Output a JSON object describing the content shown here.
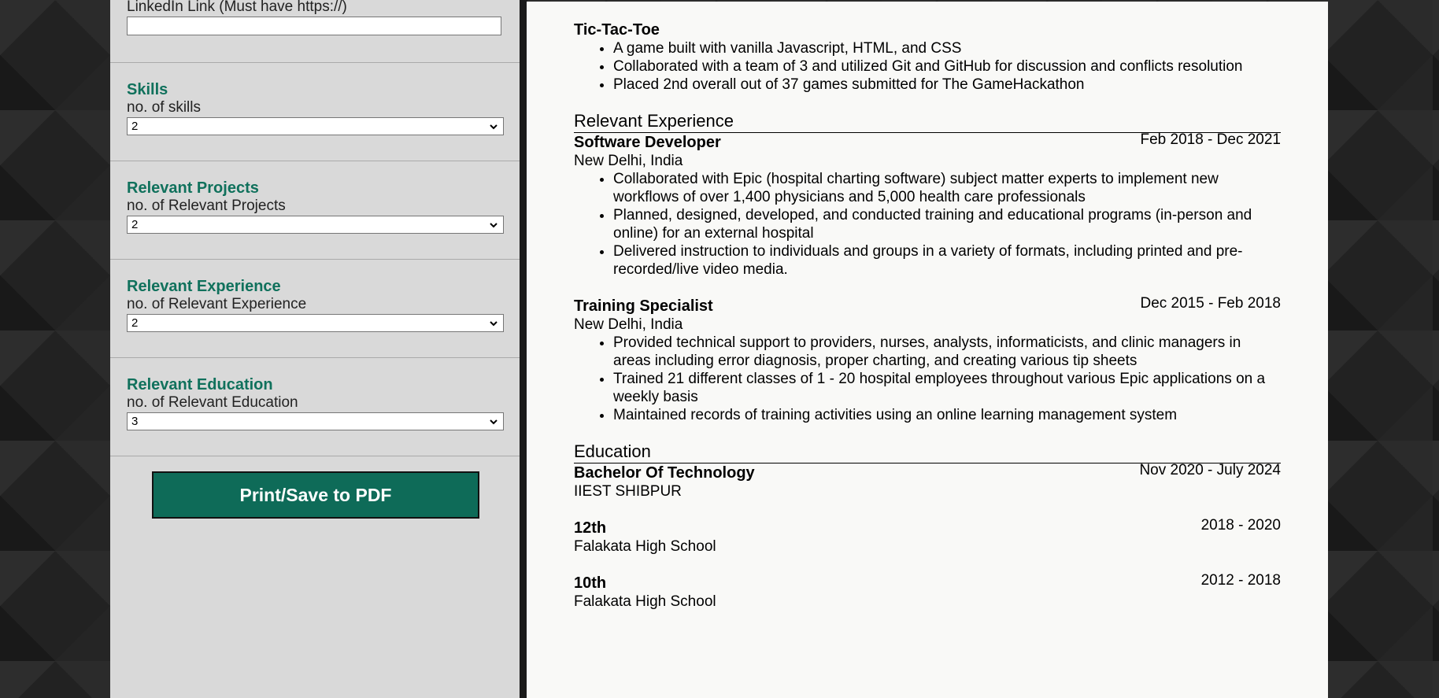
{
  "form": {
    "linkedin_label": "LinkedIn Link (Must have https://)",
    "linkedin_value": "",
    "sections": [
      {
        "title": "Skills",
        "sub": "no. of skills",
        "value": "2"
      },
      {
        "title": "Relevant Projects",
        "sub": "no. of Relevant Projects",
        "value": "2"
      },
      {
        "title": "Relevant Experience",
        "sub": "no. of Relevant Experience",
        "value": "2"
      },
      {
        "title": "Relevant Education",
        "sub": "no. of Relevant Education",
        "value": "3"
      }
    ],
    "print_label": "Print/Save to PDF"
  },
  "resume": {
    "project": {
      "title": "Tic-Tac-Toe",
      "bullets": [
        "A game built with vanilla Javascript, HTML, and CSS",
        "Collaborated with a team of 3 and utilized Git and GitHub for discussion and conflicts resolution",
        "Placed 2nd overall out of 37 games submitted for The GameHackathon"
      ]
    },
    "experience_heading": "Relevant Experience",
    "experience": [
      {
        "title": "Software Developer",
        "date": "Feb 2018 - Dec 2021",
        "location": "New Delhi, India",
        "bullets": [
          "Collaborated with Epic (hospital charting software) subject matter experts to implement new workflows of over 1,400 physicians and 5,000 health care professionals",
          "Planned, designed, developed, and conducted training and educational programs (in-person and online) for an external hospital",
          "Delivered instruction to individuals and groups in a variety of formats, including printed and pre-recorded/live video media."
        ]
      },
      {
        "title": "Training Specialist",
        "date": "Dec 2015 - Feb 2018",
        "location": "New Delhi, India",
        "bullets": [
          "Provided technical support to providers, nurses, analysts, informaticists, and clinic managers in areas including error diagnosis, proper charting, and creating various tip sheets",
          "Trained 21 different classes of 1 - 20 hospital employees throughout various Epic applications on a weekly basis",
          "Maintained records of training activities using an online learning management system"
        ]
      }
    ],
    "education_heading": "Education",
    "education": [
      {
        "title": "Bachelor Of Technology",
        "date": "Nov 2020 - July 2024",
        "school": "IIEST SHIBPUR"
      },
      {
        "title": "12th",
        "date": "2018 - 2020",
        "school": "Falakata High School"
      },
      {
        "title": "10th",
        "date": "2012 - 2018",
        "school": "Falakata High School"
      }
    ]
  }
}
